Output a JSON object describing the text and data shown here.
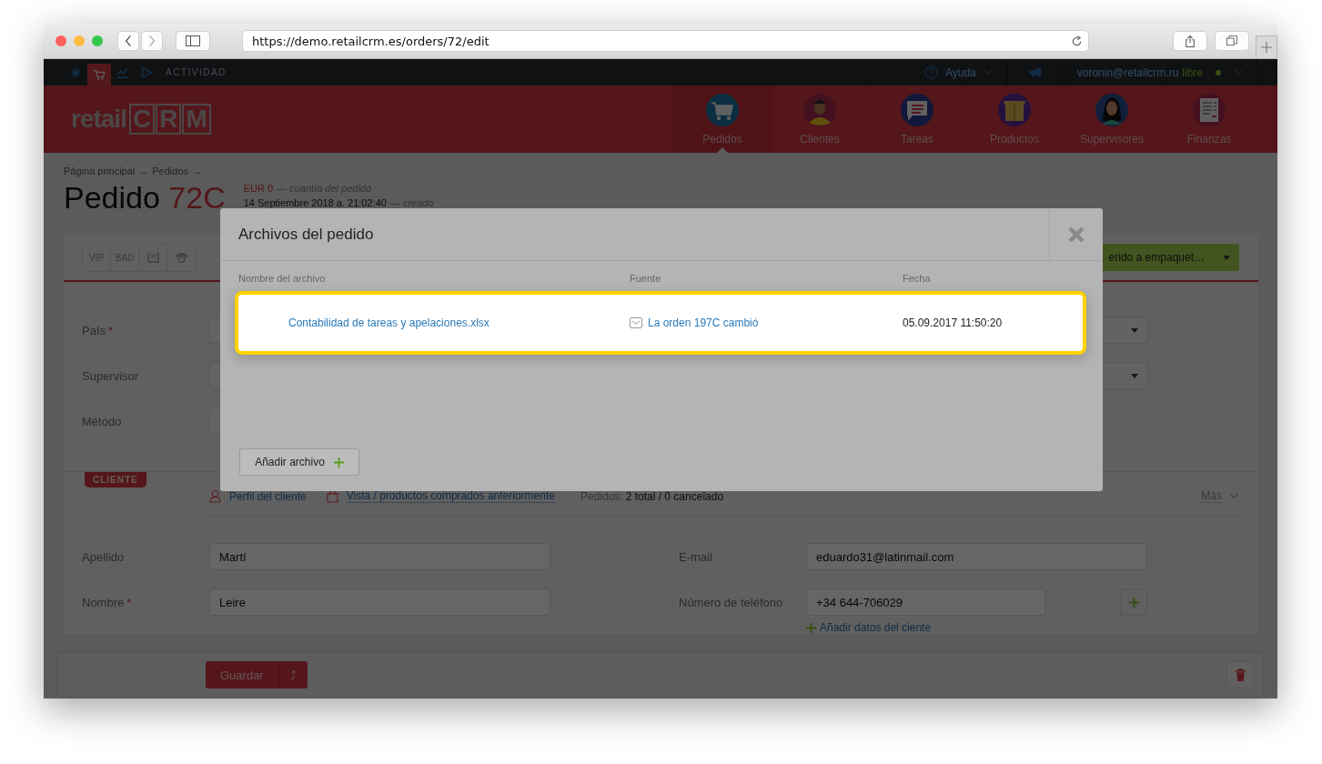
{
  "browser": {
    "url": "https://demo.retailcrm.es/orders/72/edit"
  },
  "topbar": {
    "icons": [
      {
        "kind": "gear",
        "selected": false
      },
      {
        "kind": "cart",
        "selected": true
      },
      {
        "kind": "chart",
        "selected": false
      },
      {
        "kind": "play",
        "selected": false
      }
    ],
    "activity": "ACTIVIDAD",
    "help": "Ayuda",
    "user": "voronin@retailcrm.ru",
    "plan": "libre"
  },
  "header": {
    "logo": {
      "prefix": "retail",
      "letters": [
        "C",
        "R",
        "M"
      ]
    },
    "nav": [
      {
        "label": "Pedidos",
        "kind": "cart",
        "selected": true
      },
      {
        "label": "Clientes",
        "kind": "man",
        "selected": false
      },
      {
        "label": "Tareas",
        "kind": "chat",
        "selected": false
      },
      {
        "label": "Productos",
        "kind": "box",
        "selected": false
      },
      {
        "label": "Supervisores",
        "kind": "woman",
        "selected": false
      },
      {
        "label": "Finanzas",
        "kind": "doc",
        "selected": false
      }
    ]
  },
  "page": {
    "breadcrumbs": [
      "Página principal",
      "Pedidos"
    ],
    "separator": "→",
    "title": "Pedido",
    "number": "72C",
    "sum": "EUR 0",
    "sum_note": "— cuantía del pedido",
    "created": "14 Septiembre 2018 a. 21:02:40",
    "created_note": "— creado"
  },
  "order_card": {
    "tags": [
      "VIP",
      "BAD"
    ],
    "status": {
      "value": "erido a empaquet…"
    },
    "required_mark": "*",
    "fields": [
      {
        "label": "País",
        "required": true,
        "kind": "select"
      },
      {
        "label": "Supervisor",
        "required": false,
        "kind": "select"
      },
      {
        "label": "Método",
        "required": false,
        "kind": "input"
      }
    ]
  },
  "customer": {
    "tag": "CLIENTE",
    "required_mark": "*",
    "profile_link": "Perfil del cliente",
    "history_link": "Vista / productos comprados anteriormente",
    "orders_label": "Pedidos:",
    "orders_value": "2 total / 0 cancelado",
    "more": "Más",
    "left_fields": [
      {
        "label": "Apellido",
        "required": false,
        "value": "Martí"
      },
      {
        "label": "Nombre",
        "required": true,
        "value": "Leire"
      }
    ],
    "right_fields": [
      {
        "label": "E-mail",
        "value": "eduardo31@latinmail.com",
        "addable": false
      },
      {
        "label": "Número de teléfono",
        "value": "+34 644-706029",
        "addable": true
      }
    ],
    "add_link": "Añadir datos del ciente"
  },
  "footer": {
    "save": "Guardar",
    "save_more": "⤴"
  },
  "modal": {
    "title": "Archivos del pedido",
    "columns": [
      "Nombre del archivo",
      "Fuente",
      "Fecha"
    ],
    "rows": [
      {
        "name": "Contabilidad de tareas y apelaciones.xlsx",
        "source": "La orden 197C cambió",
        "date": "05.09.2017 11:50:20",
        "highlighted": true
      }
    ],
    "add_button": "Añadir archivo"
  }
}
